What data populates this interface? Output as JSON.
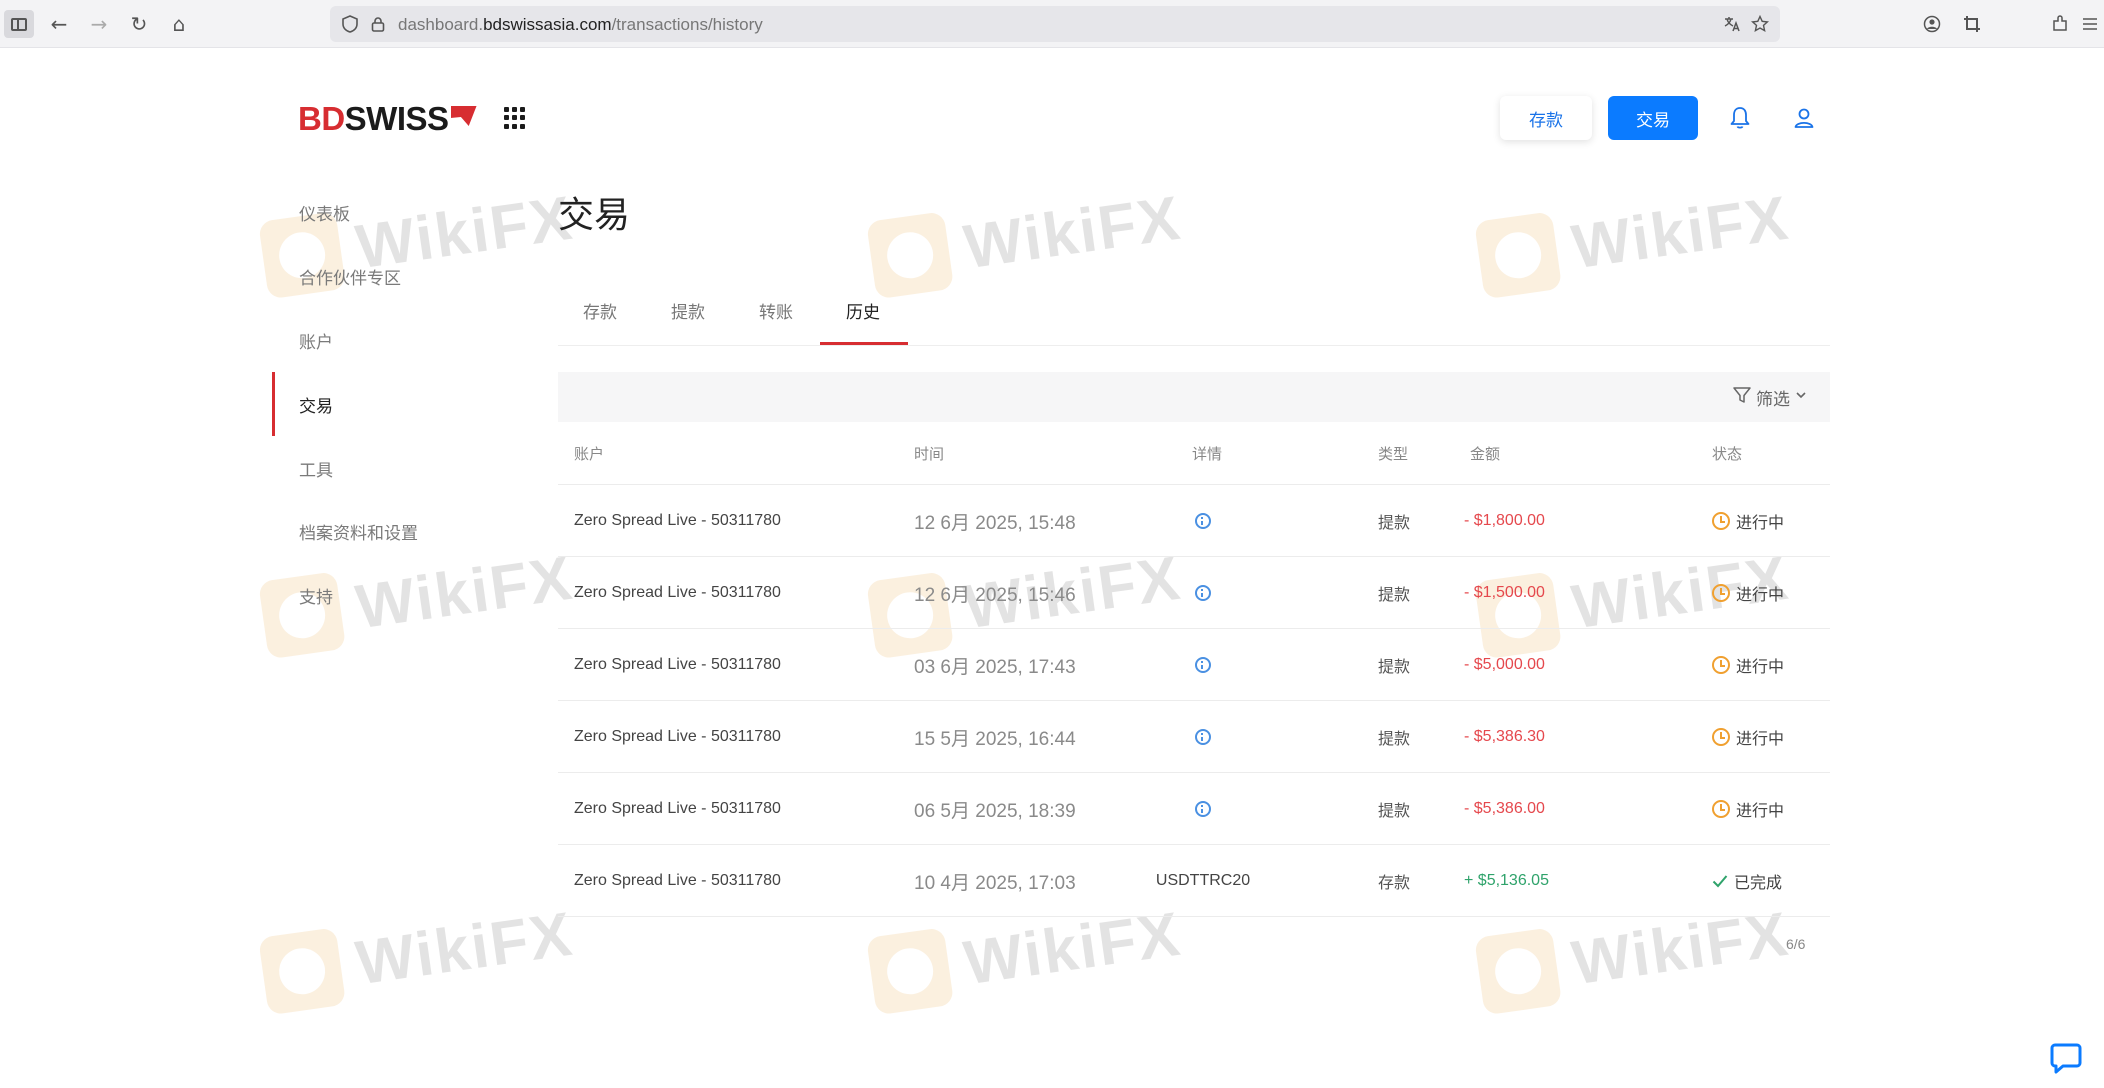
{
  "browser": {
    "url_prefix": "dashboard.",
    "url_domain": "bdswissasia.com",
    "url_path": "/transactions/history"
  },
  "header": {
    "logo_red": "BD",
    "logo_black": "SWISS",
    "deposit_label": "存款",
    "trade_label": "交易"
  },
  "sidebar": {
    "items": [
      {
        "label": "仪表板"
      },
      {
        "label": "合作伙伴专区"
      },
      {
        "label": "账户"
      },
      {
        "label": "交易"
      },
      {
        "label": "工具"
      },
      {
        "label": "档案资料和设置"
      },
      {
        "label": "支持"
      }
    ]
  },
  "main": {
    "title": "交易",
    "tabs": [
      {
        "label": "存款"
      },
      {
        "label": "提款"
      },
      {
        "label": "转账"
      },
      {
        "label": "历史"
      }
    ],
    "filter_label": "筛选",
    "columns": {
      "account": "账户",
      "time": "时间",
      "detail": "详情",
      "type": "类型",
      "amount": "金额",
      "status": "状态"
    },
    "rows": [
      {
        "account": "Zero Spread Live - 50311780",
        "time": "12 6月 2025, 15:48",
        "detail": "",
        "type": "提款",
        "amount": "- $1,800.00",
        "status": "进行中"
      },
      {
        "account": "Zero Spread Live - 50311780",
        "time": "12 6月 2025, 15:46",
        "detail": "",
        "type": "提款",
        "amount": "- $1,500.00",
        "status": "进行中"
      },
      {
        "account": "Zero Spread Live - 50311780",
        "time": "03 6月 2025, 17:43",
        "detail": "",
        "type": "提款",
        "amount": "- $5,000.00",
        "status": "进行中"
      },
      {
        "account": "Zero Spread Live - 50311780",
        "time": "15 5月 2025, 16:44",
        "detail": "",
        "type": "提款",
        "amount": "- $5,386.30",
        "status": "进行中"
      },
      {
        "account": "Zero Spread Live - 50311780",
        "time": "06 5月 2025, 18:39",
        "detail": "",
        "type": "提款",
        "amount": "- $5,386.00",
        "status": "进行中"
      },
      {
        "account": "Zero Spread Live - 50311780",
        "time": "10 4月 2025, 17:03",
        "detail": "USDTTRC20",
        "type": "存款",
        "amount": "+ $5,136.05",
        "status": "已完成"
      }
    ],
    "pagination": "6/6"
  },
  "watermark": {
    "text": "WikiFX"
  },
  "colors": {
    "brand_red": "#d72d31",
    "primary_blue": "#0b7bff",
    "negative": "#e5484d",
    "positive": "#2fa36b",
    "pending": "#f0a030"
  }
}
